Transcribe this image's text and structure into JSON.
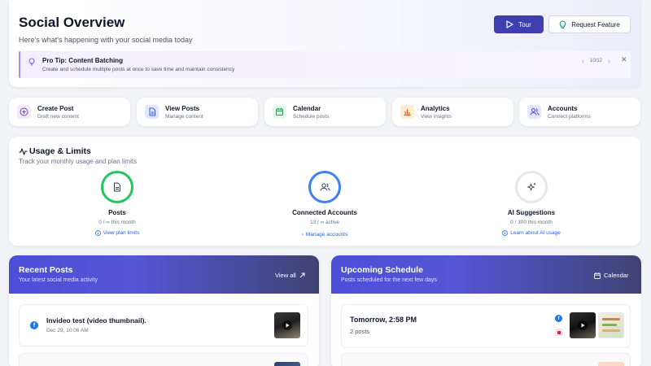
{
  "header": {
    "title": "Social Overview",
    "subtitle": "Here's what's happening with your social media today",
    "tour_label": "Tour",
    "request_label": "Request Feature"
  },
  "pro_tip": {
    "title": "Pro Tip: Content Batching",
    "text": "Create and schedule multiple posts at once to save time and maintain consistency",
    "counter": "10/12"
  },
  "quick_actions": [
    {
      "title": "Create Post",
      "subtitle": "Draft new content",
      "icon": "plus-circle-icon",
      "color": "#7c3aed",
      "bg": "#f3e8ff"
    },
    {
      "title": "View Posts",
      "subtitle": "Manage content",
      "icon": "document-icon",
      "color": "#3b5bdb",
      "bg": "#e0e7ff"
    },
    {
      "title": "Calendar",
      "subtitle": "Schedule posts",
      "icon": "calendar-icon",
      "color": "#16a34a",
      "bg": "#dcfce7"
    },
    {
      "title": "Analytics",
      "subtitle": "View insights",
      "icon": "bar-chart-icon",
      "color": "#ea580c",
      "bg": "#ffedd5"
    },
    {
      "title": "Accounts",
      "subtitle": "Connect platforms",
      "icon": "users-icon",
      "color": "#4f46e5",
      "bg": "#e0e7ff"
    }
  ],
  "usage": {
    "title": "Usage & Limits",
    "subtitle": "Track your monthly usage and plan limits",
    "metrics": [
      {
        "title": "Posts",
        "value": "0 / ∞ this month",
        "link": "View plan limits",
        "ring_color": "#22c55e"
      },
      {
        "title": "Connected Accounts",
        "value": "13 / ∞ active",
        "link": "Manage accounts",
        "ring_color": "#3b82f6"
      },
      {
        "title": "AI Suggestions",
        "value": "0 / 300 this month",
        "link": "Learn about AI usage",
        "ring_color": "#e5e7eb"
      }
    ]
  },
  "recent_posts": {
    "title": "Recent Posts",
    "subtitle": "Your latest social media activity",
    "view_all": "View all",
    "items": [
      {
        "title": "Invideo test (video thumbnail).",
        "date": "Dec 29, 10:06 AM"
      }
    ]
  },
  "upcoming": {
    "title": "Upcoming Schedule",
    "subtitle": "Posts scheduled for the next few days",
    "calendar_label": "Calendar",
    "items": [
      {
        "when": "Tomorrow, 2:58 PM",
        "count": "2 posts"
      }
    ]
  }
}
